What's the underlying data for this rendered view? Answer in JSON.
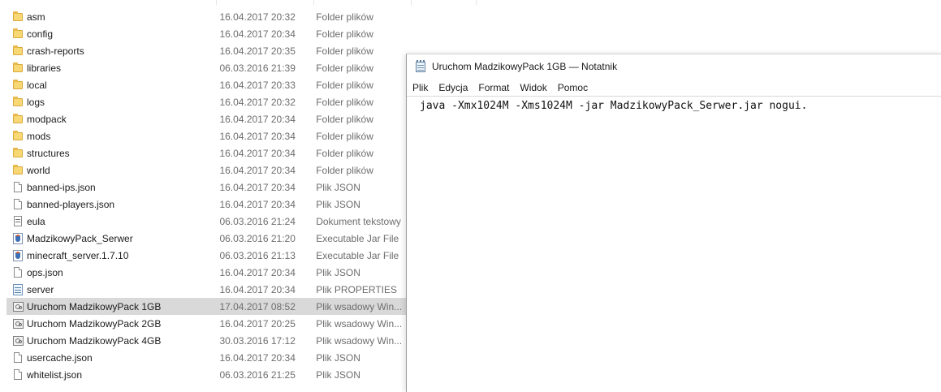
{
  "files": [
    {
      "name": "asm",
      "date": "16.04.2017 20:32",
      "type": "Folder plików",
      "icon": "folder-icon"
    },
    {
      "name": "config",
      "date": "16.04.2017 20:34",
      "type": "Folder plików",
      "icon": "folder-icon"
    },
    {
      "name": "crash-reports",
      "date": "16.04.2017 20:35",
      "type": "Folder plików",
      "icon": "folder-icon"
    },
    {
      "name": "libraries",
      "date": "06.03.2016 21:39",
      "type": "Folder plików",
      "icon": "folder-icon"
    },
    {
      "name": "local",
      "date": "16.04.2017 20:33",
      "type": "Folder plików",
      "icon": "folder-icon"
    },
    {
      "name": "logs",
      "date": "16.04.2017 20:32",
      "type": "Folder plików",
      "icon": "folder-icon"
    },
    {
      "name": "modpack",
      "date": "16.04.2017 20:34",
      "type": "Folder plików",
      "icon": "folder-icon"
    },
    {
      "name": "mods",
      "date": "16.04.2017 20:34",
      "type": "Folder plików",
      "icon": "folder-icon"
    },
    {
      "name": "structures",
      "date": "16.04.2017 20:34",
      "type": "Folder plików",
      "icon": "folder-icon"
    },
    {
      "name": "world",
      "date": "16.04.2017 20:34",
      "type": "Folder plików",
      "icon": "folder-icon"
    },
    {
      "name": "banned-ips.json",
      "date": "16.04.2017 20:34",
      "type": "Plik JSON",
      "icon": "file-icon"
    },
    {
      "name": "banned-players.json",
      "date": "16.04.2017 20:34",
      "type": "Plik JSON",
      "icon": "file-icon"
    },
    {
      "name": "eula",
      "date": "06.03.2016 21:24",
      "type": "Dokument tekstowy",
      "icon": "text-file-icon"
    },
    {
      "name": "MadzikowyPack_Serwer",
      "date": "06.03.2016 21:20",
      "type": "Executable Jar File",
      "icon": "java-jar-icon"
    },
    {
      "name": "minecraft_server.1.7.10",
      "date": "06.03.2016 21:13",
      "type": "Executable Jar File",
      "icon": "java-jar-icon"
    },
    {
      "name": "ops.json",
      "date": "16.04.2017 20:34",
      "type": "Plik JSON",
      "icon": "file-icon"
    },
    {
      "name": "server",
      "date": "16.04.2017 20:34",
      "type": "Plik PROPERTIES",
      "icon": "properties-file-icon"
    },
    {
      "name": "Uruchom MadzikowyPack 1GB",
      "date": "17.04.2017 08:52",
      "type": "Plik wsadowy Win...",
      "icon": "batch-file-icon",
      "selected": true
    },
    {
      "name": "Uruchom MadzikowyPack 2GB",
      "date": "16.04.2017 20:25",
      "type": "Plik wsadowy Win...",
      "icon": "batch-file-icon"
    },
    {
      "name": "Uruchom MadzikowyPack 4GB",
      "date": "30.03.2016 17:12",
      "type": "Plik wsadowy Win...",
      "icon": "batch-file-icon"
    },
    {
      "name": "usercache.json",
      "date": "16.04.2017 20:34",
      "type": "Plik JSON",
      "icon": "file-icon"
    },
    {
      "name": "whitelist.json",
      "date": "06.03.2016 21:25",
      "type": "Plik JSON",
      "icon": "file-icon"
    }
  ],
  "notepad": {
    "title": "Uruchom MadzikowyPack 1GB — Notatnik",
    "icon": "notepad-icon",
    "menu": [
      "Plik",
      "Edycja",
      "Format",
      "Widok",
      "Pomoc"
    ],
    "content": "java -Xmx1024M -Xms1024M -jar MadzikowyPack_Serwer.jar nogui."
  },
  "colors": {
    "selected_row": "#d9d9d9",
    "secondary_text": "#6d6d6d",
    "folder": "#f8d775"
  }
}
